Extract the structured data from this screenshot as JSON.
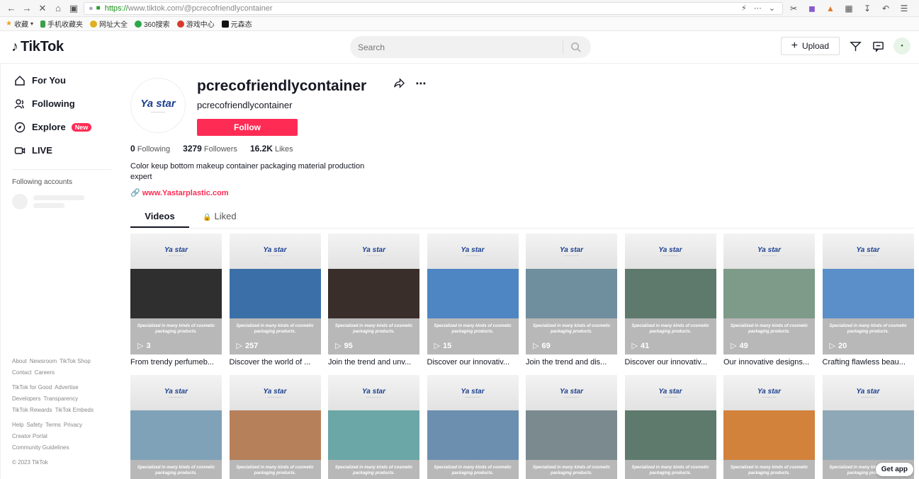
{
  "browser": {
    "url_scheme": "https://",
    "url_rest": "www.tiktok.com/@pcrecofriendlycontainer",
    "bookmarks": [
      "收藏",
      "手机收藏夹",
      "网址大全",
      "360搜索",
      "游戏中心",
      "元森态"
    ]
  },
  "header": {
    "logo": "TikTok",
    "search_placeholder": "Search",
    "upload_label": "Upload"
  },
  "sidebar": {
    "items": [
      {
        "label": "For You",
        "icon": "home-icon"
      },
      {
        "label": "Following",
        "icon": "users-icon"
      },
      {
        "label": "Explore",
        "icon": "compass-icon",
        "badge": "New"
      },
      {
        "label": "LIVE",
        "icon": "live-icon"
      }
    ],
    "following_title": "Following accounts",
    "footer": [
      [
        "About",
        "Newsroom",
        "TikTok Shop",
        "Contact",
        "Careers"
      ],
      [
        "TikTok for Good",
        "Advertise",
        "Developers",
        "Transparency",
        "TikTok Rewards",
        "TikTok Embeds"
      ],
      [
        "Help",
        "Safety",
        "Terms",
        "Privacy",
        "Creator Portal",
        "Community Guidelines"
      ],
      [
        "© 2023 TikTok"
      ]
    ]
  },
  "profile": {
    "title": "pcrecofriendlycontainer",
    "subtitle": "pcrecofriendlycontainer",
    "follow_label": "Follow",
    "avatar_text": "Ya star",
    "stats": {
      "following_count": "0",
      "following_label": "Following",
      "followers_count": "3279",
      "followers_label": "Followers",
      "likes_count": "16.2K",
      "likes_label": "Likes"
    },
    "bio": "Color keup bottom makeup container packaging material production expert",
    "link": "www.Yastarplastic.com"
  },
  "tabs": {
    "videos": "Videos",
    "liked": "Liked"
  },
  "thumb_brand": "Ya star",
  "thumb_tagline": "Specialized in many kinds of cosmetic packaging products.",
  "videos_row1": [
    {
      "views": "3",
      "caption": "From trendy perfumeb...",
      "color": "#2f2f2f"
    },
    {
      "views": "257",
      "caption": "Discover the world of ...",
      "color": "#3b6fa8"
    },
    {
      "views": "95",
      "caption": "Join the trend and unv...",
      "color": "#3a2e2a"
    },
    {
      "views": "15",
      "caption": "Discover our innovativ...",
      "color": "#4d86c2"
    },
    {
      "views": "69",
      "caption": "Join the trend and dis...",
      "color": "#6f8e9e"
    },
    {
      "views": "41",
      "caption": "Discover our innovativ...",
      "color": "#5e7a6c"
    },
    {
      "views": "49",
      "caption": "Our innovative designs...",
      "color": "#7e9a88"
    },
    {
      "views": "20",
      "caption": "Crafting flawless beau...",
      "color": "#5a8fc9"
    }
  ],
  "videos_row2": [
    {
      "color": "#7fa2b8"
    },
    {
      "color": "#b5805a"
    },
    {
      "color": "#6aa7a6"
    },
    {
      "color": "#6c8fb0"
    },
    {
      "color": "#7b8a8f"
    },
    {
      "color": "#5e7a6c"
    },
    {
      "color": "#d2823a"
    },
    {
      "color": "#8fa8b8"
    }
  ],
  "get_app": "Get app"
}
